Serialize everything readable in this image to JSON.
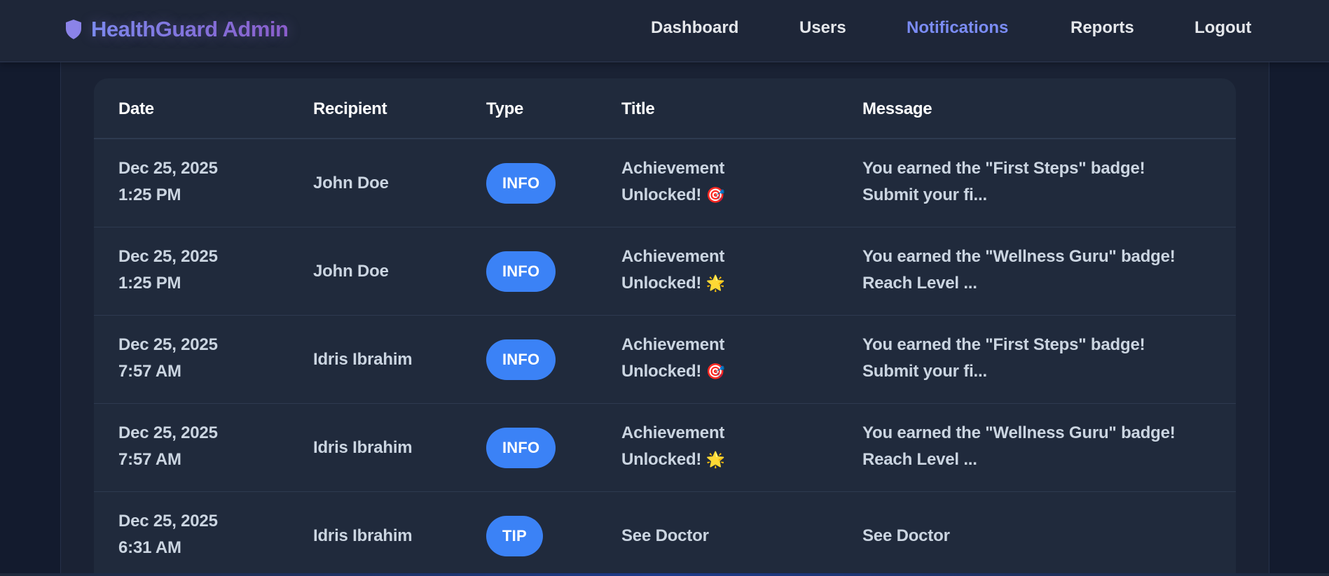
{
  "nav": {
    "brand": "HealthGuard Admin",
    "links": [
      {
        "label": "Dashboard",
        "active": false
      },
      {
        "label": "Users",
        "active": false
      },
      {
        "label": "Notifications",
        "active": true
      },
      {
        "label": "Reports",
        "active": false
      },
      {
        "label": "Logout",
        "active": false
      }
    ]
  },
  "table": {
    "headers": [
      "Date",
      "Recipient",
      "Type",
      "Title",
      "Message"
    ],
    "rows": [
      {
        "date": "Dec 25, 2025",
        "time": "1:25 PM",
        "recipient": "John Doe",
        "type": "INFO",
        "title_line1": "Achievement",
        "title_line2": "Unlocked!",
        "title_emoji": "🎯",
        "message_line1": "You earned the \"First Steps\" badge!",
        "message_line2": "Submit your fi..."
      },
      {
        "date": "Dec 25, 2025",
        "time": "1:25 PM",
        "recipient": "John Doe",
        "type": "INFO",
        "title_line1": "Achievement",
        "title_line2": "Unlocked!",
        "title_emoji": "🌟",
        "message_line1": "You earned the \"Wellness Guru\" badge!",
        "message_line2": "Reach Level ..."
      },
      {
        "date": "Dec 25, 2025",
        "time": "7:57 AM",
        "recipient": "Idris Ibrahim",
        "type": "INFO",
        "title_line1": "Achievement",
        "title_line2": "Unlocked!",
        "title_emoji": "🎯",
        "message_line1": "You earned the \"First Steps\" badge!",
        "message_line2": "Submit your fi..."
      },
      {
        "date": "Dec 25, 2025",
        "time": "7:57 AM",
        "recipient": "Idris Ibrahim",
        "type": "INFO",
        "title_line1": "Achievement",
        "title_line2": "Unlocked!",
        "title_emoji": "🌟",
        "message_line1": "You earned the \"Wellness Guru\" badge!",
        "message_line2": "Reach Level ..."
      },
      {
        "date": "Dec 25, 2025",
        "time": "6:31 AM",
        "recipient": "Idris Ibrahim",
        "type": "TIP",
        "title": "See Doctor",
        "message": "See Doctor"
      }
    ]
  },
  "colors": {
    "accent": "#7b8cf5",
    "badge": "#3b82f6",
    "background": "#111827",
    "card": "#202a3c"
  },
  "icons": {
    "brand": "shield-icon",
    "target_emoji": "direct-hit-icon",
    "star_emoji": "glowing-star-icon"
  }
}
